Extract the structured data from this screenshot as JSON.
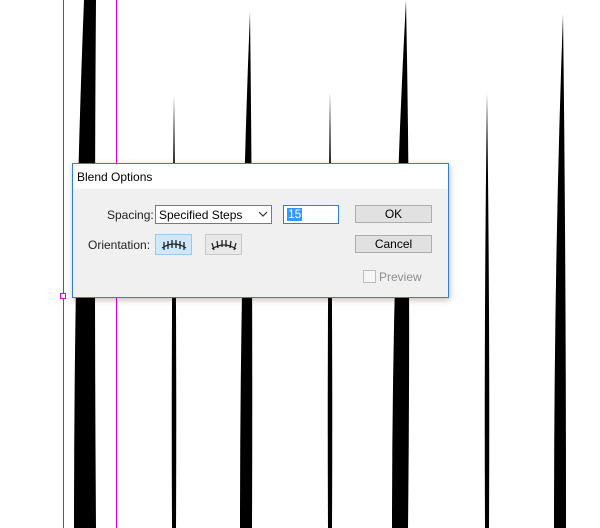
{
  "dialog": {
    "title": "Blend Options",
    "spacing_label": "Spacing:",
    "spacing_value": "Specified Steps",
    "steps_value": "15",
    "orientation_label": "Orientation:",
    "orientation_selected": "align-to-page",
    "ok_label": "OK",
    "cancel_label": "Cancel",
    "preview_label": "Preview",
    "preview_checked": false,
    "preview_enabled": false
  },
  "colors": {
    "guide": "#e000e0",
    "stroke": "#000000",
    "dialog_border": "#2f7ed8",
    "selection": "#3399ff",
    "orient_selected_bg": "#cde8ff"
  }
}
